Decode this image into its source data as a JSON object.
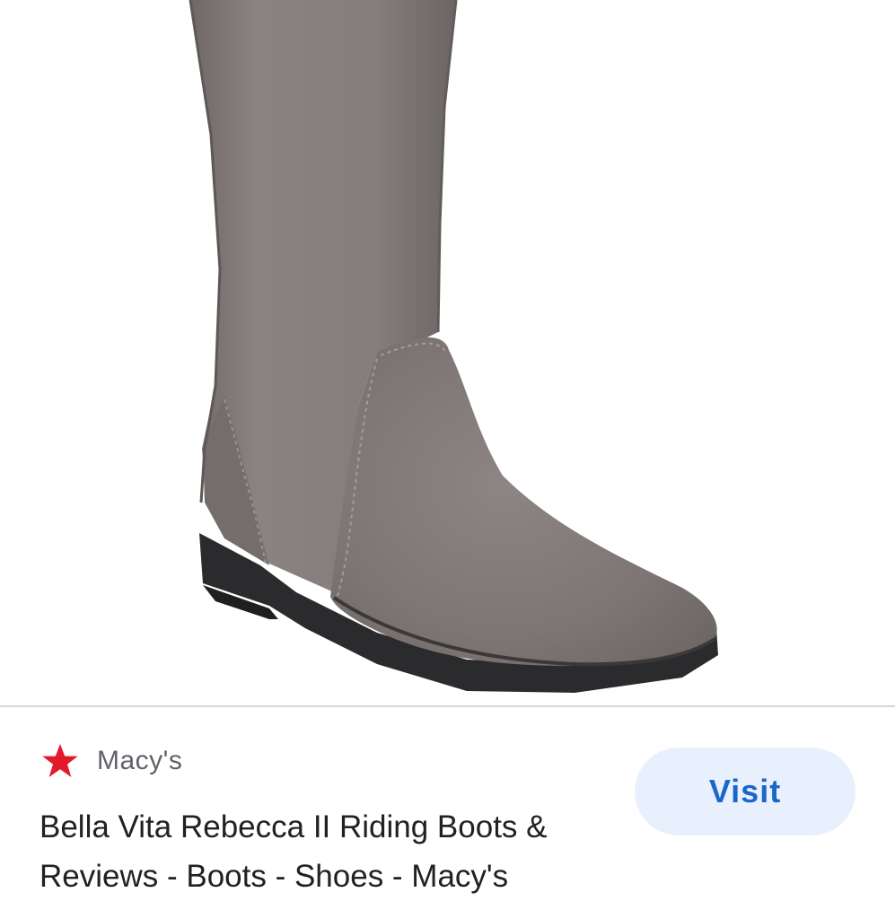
{
  "result": {
    "source": {
      "name": "Macy's",
      "icon": "star-icon",
      "icon_color": "#e21a2c"
    },
    "title": "Bella Vita Rebecca II Riding Boots & Reviews - Boots - Shoes - Macy's",
    "visit_label": "Visit"
  },
  "colors": {
    "visit_bg": "#e8f0fe",
    "visit_text": "#1a67c9",
    "boot_gray": "#827b79"
  }
}
